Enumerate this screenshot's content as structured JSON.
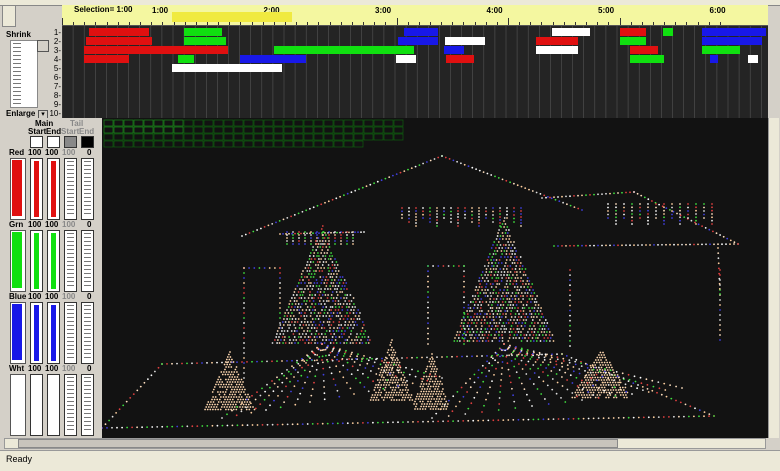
{
  "timeline": {
    "selection_label": "Selection= 1:00",
    "ticks": [
      "1:00",
      "2:00",
      "3:00",
      "4:00",
      "5:00",
      "6:00"
    ]
  },
  "channels": {
    "row_labels": [
      "1-",
      "2-",
      "3-",
      "4-",
      "5-",
      "6-",
      "7-",
      "8-",
      "9-",
      "10-"
    ]
  },
  "zoom": {
    "shrink_label": "Shrink",
    "enlarge_label": "Enlarge"
  },
  "color_panel": {
    "main_label": "Main",
    "tail_label": "Tail",
    "start_label": "Start",
    "end_label": "End",
    "rows": [
      {
        "label": "Red",
        "main_start": "100",
        "main_end": "100",
        "tail_start": "100",
        "tail_end": "0",
        "color": "#e01010"
      },
      {
        "label": "Grn",
        "main_start": "100",
        "main_end": "100",
        "tail_start": "100",
        "tail_end": "0",
        "color": "#10e010"
      },
      {
        "label": "Blue",
        "main_start": "100",
        "main_end": "100",
        "tail_start": "100",
        "tail_end": "0",
        "color": "#1818e8"
      },
      {
        "label": "Wht",
        "main_start": "100",
        "main_end": "100",
        "tail_start": "100",
        "tail_end": "0",
        "color": "#ffffff"
      }
    ]
  },
  "status": {
    "text": "Ready"
  },
  "colors": {
    "red": "#e01010",
    "green": "#10e010",
    "blue": "#1818e8",
    "white": "#ffffff"
  }
}
